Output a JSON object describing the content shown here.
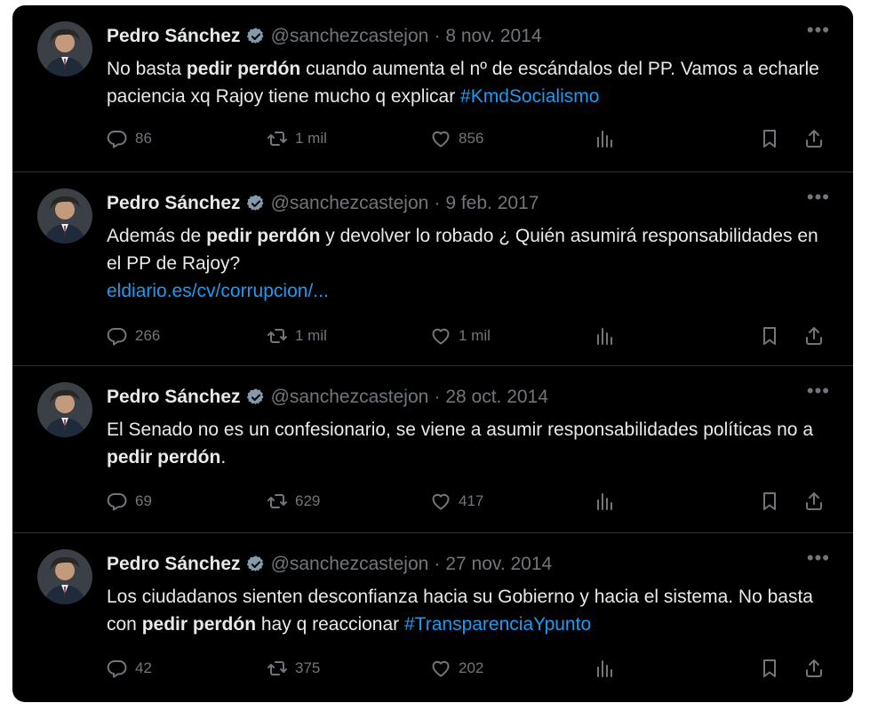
{
  "tweets": [
    {
      "name": "Pedro Sánchez",
      "handle": "@sanchezcastejon",
      "separator": "·",
      "date": "8 nov. 2014",
      "text_parts": [
        {
          "t": "No basta "
        },
        {
          "t": "pedir perdón",
          "bold": true
        },
        {
          "t": " cuando aumenta el nº de escándalos del PP. Vamos a echarle paciencia xq Rajoy tiene mucho q explicar "
        },
        {
          "t": "#KmdSocialismo",
          "link": true
        }
      ],
      "replies": "86",
      "retweets": "1 mil",
      "likes": "856"
    },
    {
      "name": "Pedro Sánchez",
      "handle": "@sanchezcastejon",
      "separator": "·",
      "date": "9 feb. 2017",
      "text_parts": [
        {
          "t": "Además de "
        },
        {
          "t": "pedir perdón",
          "bold": true
        },
        {
          "t": " y devolver lo robado ¿ Quién asumirá responsabilidades en el PP de Rajoy? "
        },
        {
          "t": "eldiario.es/cv/corrupcion/...",
          "link": true,
          "block": true
        }
      ],
      "replies": "266",
      "retweets": "1 mil",
      "likes": "1 mil"
    },
    {
      "name": "Pedro Sánchez",
      "handle": "@sanchezcastejon",
      "separator": "·",
      "date": "28 oct. 2014",
      "text_parts": [
        {
          "t": "El Senado no es un confesionario, se viene a asumir responsabilidades políticas no a "
        },
        {
          "t": "pedir perdón",
          "bold": true
        },
        {
          "t": "."
        }
      ],
      "replies": "69",
      "retweets": "629",
      "likes": "417"
    },
    {
      "name": "Pedro Sánchez",
      "handle": "@sanchezcastejon",
      "separator": "·",
      "date": "27 nov. 2014",
      "text_parts": [
        {
          "t": "Los ciudadanos sienten desconfianza hacia su Gobierno y hacia el sistema. No basta con "
        },
        {
          "t": "pedir perdón",
          "bold": true
        },
        {
          "t": " hay q reaccionar "
        },
        {
          "t": "#TransparenciaYpunto",
          "link": true
        }
      ],
      "replies": "42",
      "retweets": "375",
      "likes": "202"
    }
  ],
  "colors": {
    "background": "#000000",
    "text": "#e7e9ea",
    "muted": "#71767b",
    "link": "#1d9bf0",
    "verified": "#829aab"
  },
  "icons": {
    "reply": "reply-icon",
    "retweet": "retweet-icon",
    "like": "heart-icon",
    "views": "views-icon",
    "bookmark": "bookmark-icon",
    "share": "share-icon",
    "more": "more-icon",
    "verified": "verified-badge-icon"
  }
}
